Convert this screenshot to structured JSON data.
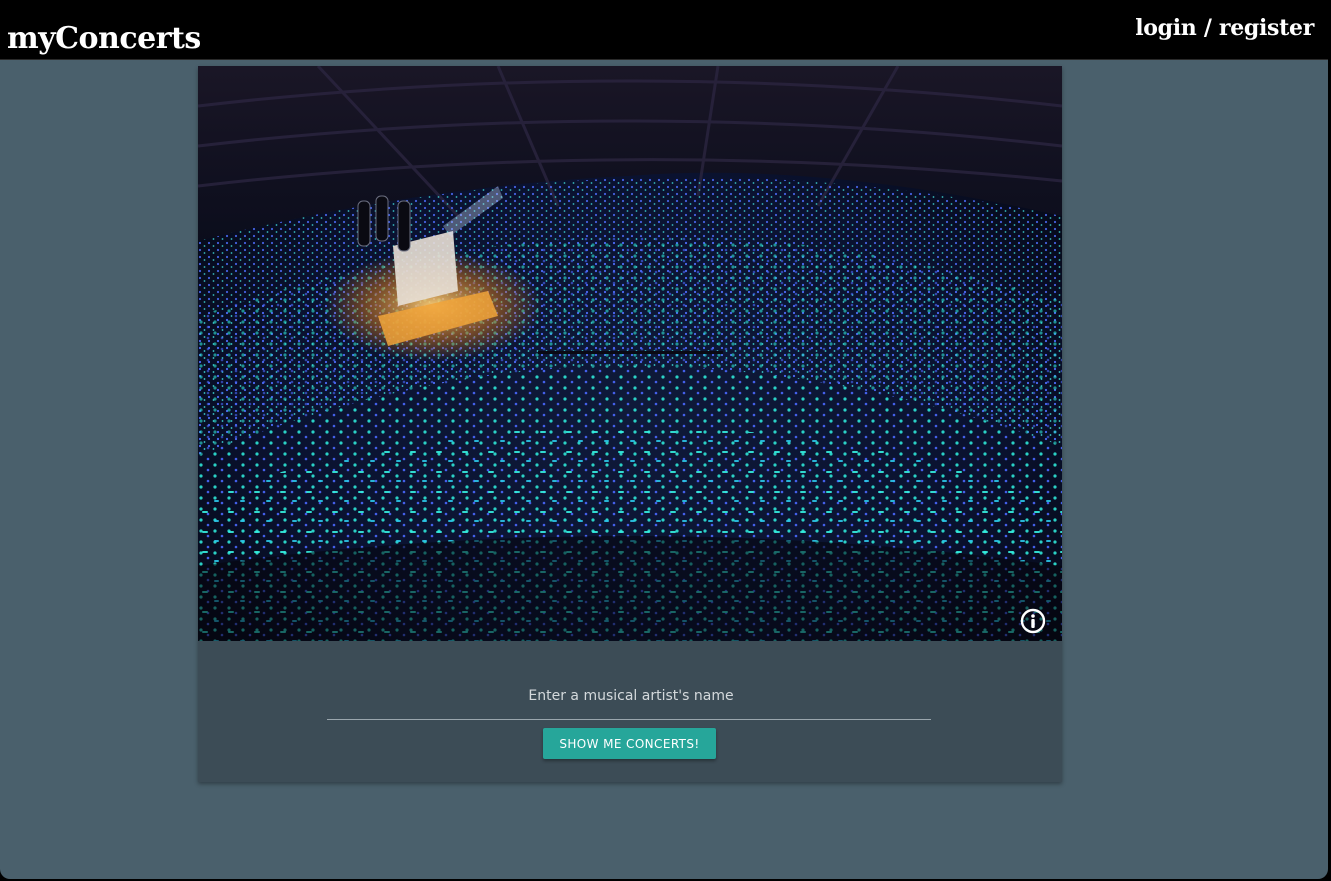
{
  "navbar": {
    "brand": "myConcerts",
    "auth_link": "login / register"
  },
  "hero": {
    "image_description": "arena-concert-crowd-with-lightsticks",
    "info_icon": "info-icon"
  },
  "search": {
    "placeholder": "Enter a musical artist's name",
    "value": "",
    "submit_label": "Show me concerts!"
  },
  "colors": {
    "page_background": "#4a606c",
    "card_background": "#3c4c56",
    "navbar_background": "#000000",
    "button_background": "#26a69a"
  }
}
